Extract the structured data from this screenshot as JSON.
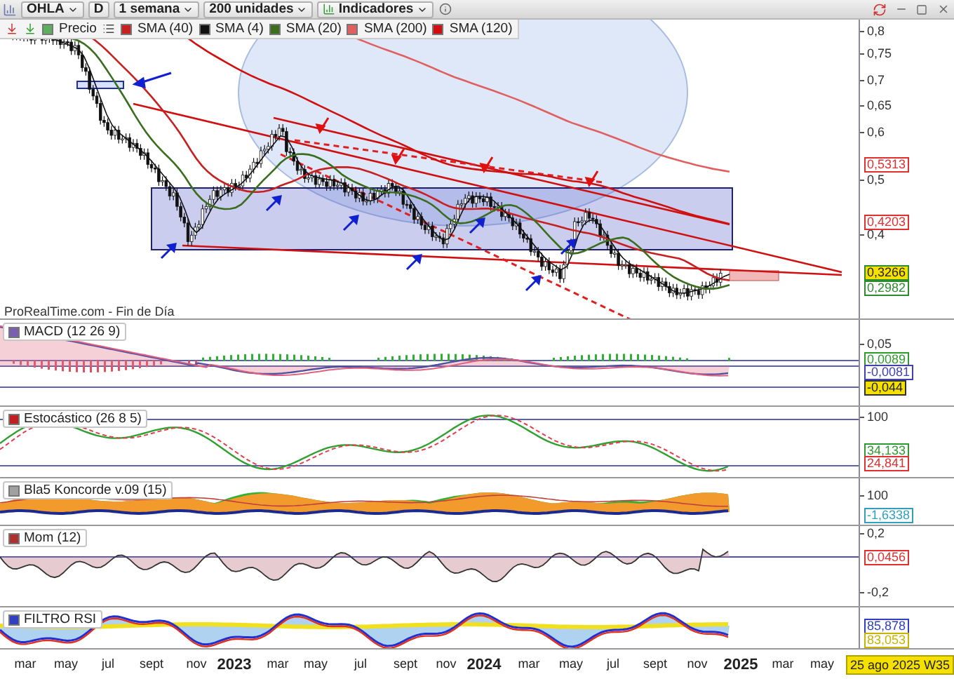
{
  "toolbar": {
    "symbol": "OHLA",
    "period_button": "D",
    "interval": "1 semana",
    "units": "200 unidades",
    "indicators": "Indicadores"
  },
  "legend": [
    {
      "label": "Precio",
      "color": "#5fae5f"
    },
    {
      "label": "SMA (40)",
      "color": "#c62020"
    },
    {
      "label": "SMA (4)",
      "color": "#111111"
    },
    {
      "label": "SMA (20)",
      "color": "#3a6e1e"
    },
    {
      "label": "SMA (200)",
      "color": "#e06060"
    },
    {
      "label": "SMA (120)",
      "color": "#d01010"
    }
  ],
  "source_label": "ProRealTime.com - Fin de Día",
  "price_panel": {
    "axis_ticks": [
      "0,8",
      "0,75",
      "0,7",
      "0,65",
      "0,6",
      "0,5",
      "0,4"
    ],
    "value_tags": [
      {
        "text": "0,5313",
        "color": "#e03030",
        "highlighted": false
      },
      {
        "text": "0,4203",
        "color": "#e03030",
        "highlighted": false
      },
      {
        "text": "0,3266",
        "color": "#2e8b2e",
        "highlighted": true
      },
      {
        "text": "0,2982",
        "color": "#2e8b2e",
        "highlighted": false
      }
    ]
  },
  "indicator_panels": [
    {
      "kind": "macd",
      "title": "MACD (12 26 9)",
      "color": "#7a5fb0",
      "axis_ticks": [
        "0,05"
      ],
      "value_tags": [
        {
          "text": "0,0089",
          "color": "#2e9b2e",
          "highlighted": false
        },
        {
          "text": "-0,0081",
          "color": "#4040b0",
          "highlighted": false
        },
        {
          "text": "-0,044",
          "color": "#333333",
          "highlighted": true
        }
      ]
    },
    {
      "kind": "stochastic",
      "title": "Estocástico (26 8 5)",
      "color": "#c02020",
      "axis_ticks": [
        "100"
      ],
      "value_tags": [
        {
          "text": "34,133",
          "color": "#2e9b2e",
          "highlighted": false
        },
        {
          "text": "24,841",
          "color": "#e03030",
          "highlighted": false
        }
      ]
    },
    {
      "kind": "koncorde",
      "title": "Bla5 Koncorde v.09 (15)",
      "color": "#a0a0a0",
      "axis_ticks": [
        "100"
      ],
      "value_tags": [
        {
          "text": "-1,6338",
          "color": "#30a0c0",
          "highlighted": false
        }
      ]
    },
    {
      "kind": "momentum",
      "title": "Mom (12)",
      "color": "#b03030",
      "axis_ticks": [
        "0,2",
        "-0,2"
      ],
      "value_tags": [
        {
          "text": "0,0456",
          "color": "#e03030",
          "highlighted": false
        }
      ]
    },
    {
      "kind": "rsi",
      "title": "FILTRO RSI",
      "color": "#3040c0",
      "value_tags": [
        {
          "text": "85,878",
          "color": "#3040c0",
          "highlighted": false
        },
        {
          "text": "83,053",
          "color": "#c8b400",
          "highlighted": false
        }
      ]
    }
  ],
  "time_axis": {
    "labels": [
      {
        "text": "mar",
        "year": false
      },
      {
        "text": "may",
        "year": false
      },
      {
        "text": "jul",
        "year": false
      },
      {
        "text": "sept",
        "year": false
      },
      {
        "text": "nov",
        "year": false
      },
      {
        "text": "2023",
        "year": true
      },
      {
        "text": "mar",
        "year": false
      },
      {
        "text": "may",
        "year": false
      },
      {
        "text": "jul",
        "year": false
      },
      {
        "text": "sept",
        "year": false
      },
      {
        "text": "nov",
        "year": false
      },
      {
        "text": "2024",
        "year": true
      },
      {
        "text": "mar",
        "year": false
      },
      {
        "text": "may",
        "year": false
      },
      {
        "text": "jul",
        "year": false
      },
      {
        "text": "sept",
        "year": false
      },
      {
        "text": "nov",
        "year": false
      },
      {
        "text": "2025",
        "year": true
      },
      {
        "text": "mar",
        "year": false
      },
      {
        "text": "may",
        "year": false
      }
    ],
    "date_tag": "25 ago 2025 W35"
  }
}
